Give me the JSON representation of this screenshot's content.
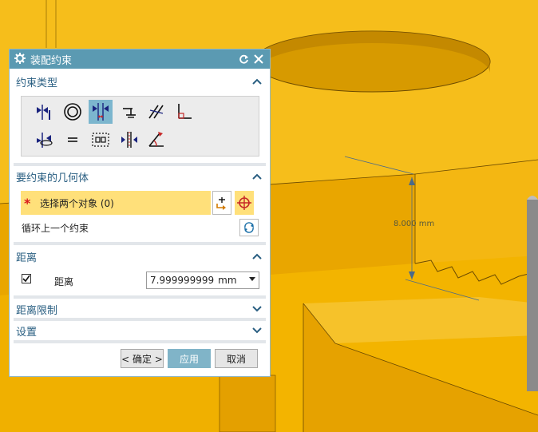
{
  "dialog": {
    "title": "装配约束",
    "sections": {
      "constraint_type": "约束类型",
      "geometry": "要约束的几何体",
      "distance": "距离",
      "distance_limits": "距离限制",
      "settings": "设置"
    },
    "geometry": {
      "select_label": "选择两个对象 (0)",
      "required_marker": "*",
      "cycle_label": "循环上一个约束"
    },
    "distance": {
      "label": "距离",
      "value": "7.999999999",
      "unit": "mm",
      "checked": true
    },
    "buttons": {
      "ok": "< 确定 >",
      "apply": "应用",
      "cancel": "取消"
    }
  },
  "viewport": {
    "model_color": "#f3b400",
    "dimension_label": "8.000 mm"
  },
  "colors": {
    "titlebar": "#5b9ab2",
    "section_header_text": "#2a5f82",
    "selected_icon_bg": "#7cb6ce",
    "selection_row_bg": "#ffe07a",
    "primary_button_bg": "#80b4c8"
  },
  "icons": [
    "touch-align-icon",
    "concentric-icon",
    "distance-icon",
    "fix-icon",
    "parallel-icon",
    "perpendicular-icon",
    "align-lock-icon",
    "equal-size-icon",
    "fit-icon",
    "bond-icon",
    "center-icon",
    "angle-icon"
  ]
}
